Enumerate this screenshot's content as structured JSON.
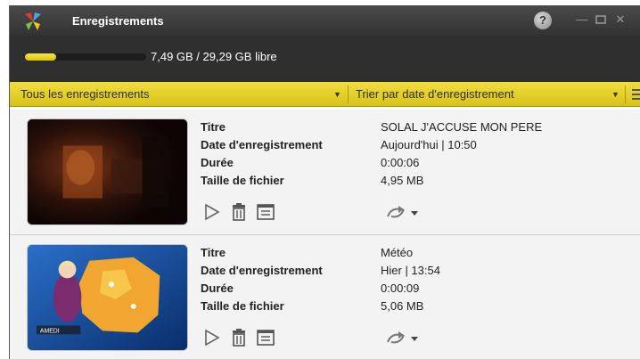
{
  "window": {
    "title": "Enregistrements",
    "help_label": "?"
  },
  "storage": {
    "used_fraction": 0.256,
    "text": "7,49 GB / 29,29 GB libre"
  },
  "filters": {
    "filter_label": "Tous les enregistrements",
    "sort_label": "Trier par date d'enregistrement"
  },
  "field_labels": {
    "title": "Titre",
    "date": "Date d'enregistrement",
    "duration": "Durée",
    "size": "Taille de fichier"
  },
  "recordings": [
    {
      "title": "SOLAL  J'ACCUSE MON PERE",
      "date": "Aujourd'hui  |  10:50",
      "duration": "0:00:06",
      "size": "4,95 MB"
    },
    {
      "title": "Météo",
      "date": "Hier  |  13:54",
      "duration": "0:00:09",
      "size": "5,06 MB"
    }
  ],
  "colors": {
    "accent_yellow": "#e6d12a",
    "titlebar": "#3a3a3a",
    "row_bg": "#f3f3f3"
  },
  "icons": [
    "app-logo-icon",
    "help-icon",
    "minimize-icon",
    "maximize-icon",
    "close-icon",
    "dropdown-arrow-icon",
    "menu-icon",
    "play-icon",
    "trash-icon",
    "details-icon",
    "share-icon"
  ]
}
